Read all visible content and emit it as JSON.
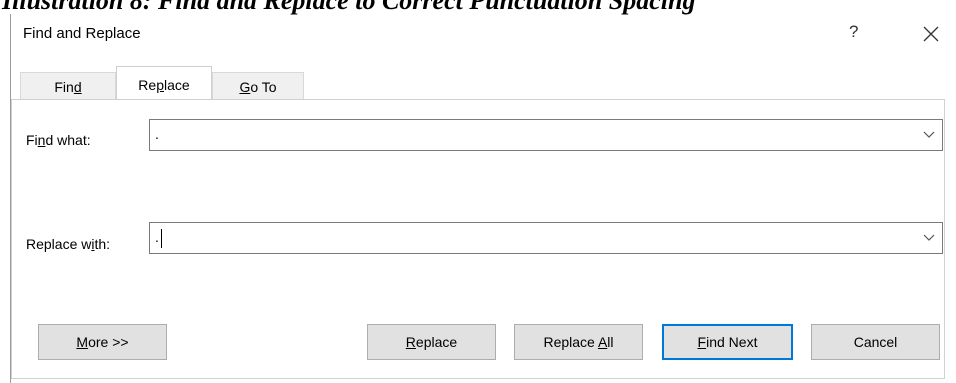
{
  "caption": {
    "text": "Illustration 8: Find and Replace to Correct Punctuation Spacing"
  },
  "window": {
    "title": "Find and Replace",
    "help": "?"
  },
  "tabs": [
    {
      "pre": "Fin",
      "key": "d",
      "post": ""
    },
    {
      "pre": "Re",
      "key": "p",
      "post": "lace"
    },
    {
      "pre": "",
      "key": "G",
      "post": "o To"
    }
  ],
  "find": {
    "label_pre": "Fi",
    "label_key": "n",
    "label_post": "d what:",
    "value": "."
  },
  "replace": {
    "label_pre": "Replace w",
    "label_key": "i",
    "label_post": "th:",
    "value": "."
  },
  "buttons": {
    "more": {
      "key": "M",
      "post": "ore >>"
    },
    "replace": {
      "key": "R",
      "post": "eplace"
    },
    "replace_all": {
      "pre": "Replace ",
      "key": "A",
      "post": "ll"
    },
    "find_next": {
      "key": "F",
      "post": "ind Next"
    },
    "cancel": {
      "label": "Cancel"
    }
  }
}
